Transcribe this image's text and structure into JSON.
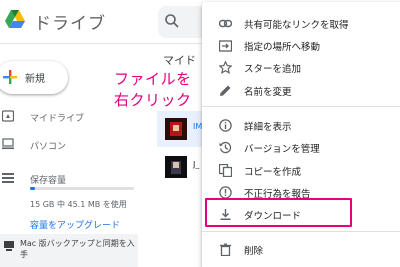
{
  "app": {
    "title": "ドライブ"
  },
  "sidebar": {
    "new_label": "新規",
    "items": [
      {
        "label": "マイドライブ",
        "icon": "my-drive-icon"
      },
      {
        "label": "パソコン",
        "icon": "computer-icon"
      },
      {
        "label": "保存容量",
        "icon": "storage-icon"
      }
    ],
    "storage_usage_fraction": 0.05,
    "storage_text": "15 GB 中 45.1 MB を使用",
    "upgrade_label": "容量をアップグレード",
    "promo_text": "Mac 版バックアップと同期を入手"
  },
  "main": {
    "title": "マイド",
    "rows": [
      {
        "name": "IMG"
      },
      {
        "name": "J_"
      }
    ]
  },
  "annotation": {
    "line1": "ファイルを",
    "line2": "右クリック"
  },
  "context_menu": {
    "items": [
      {
        "label": "共有可能なリンクを取得",
        "icon": "link-icon"
      },
      {
        "label": "指定の場所へ移動",
        "icon": "move-to-folder-icon"
      },
      {
        "label": "スターを追加",
        "icon": "star-icon"
      },
      {
        "label": "名前を変更",
        "icon": "pencil-icon"
      },
      {
        "label": "詳細を表示",
        "icon": "info-icon"
      },
      {
        "label": "バージョンを管理",
        "icon": "history-icon"
      },
      {
        "label": "コピーを作成",
        "icon": "copy-icon"
      },
      {
        "label": "不正行為を報告",
        "icon": "report-icon"
      },
      {
        "label": "ダウンロード",
        "icon": "download-icon"
      },
      {
        "label": "削除",
        "icon": "trash-icon"
      }
    ]
  },
  "colors": {
    "accent": "#1a73e8",
    "annotation": "#e6007e",
    "selected_row": "#e8f0fe"
  }
}
